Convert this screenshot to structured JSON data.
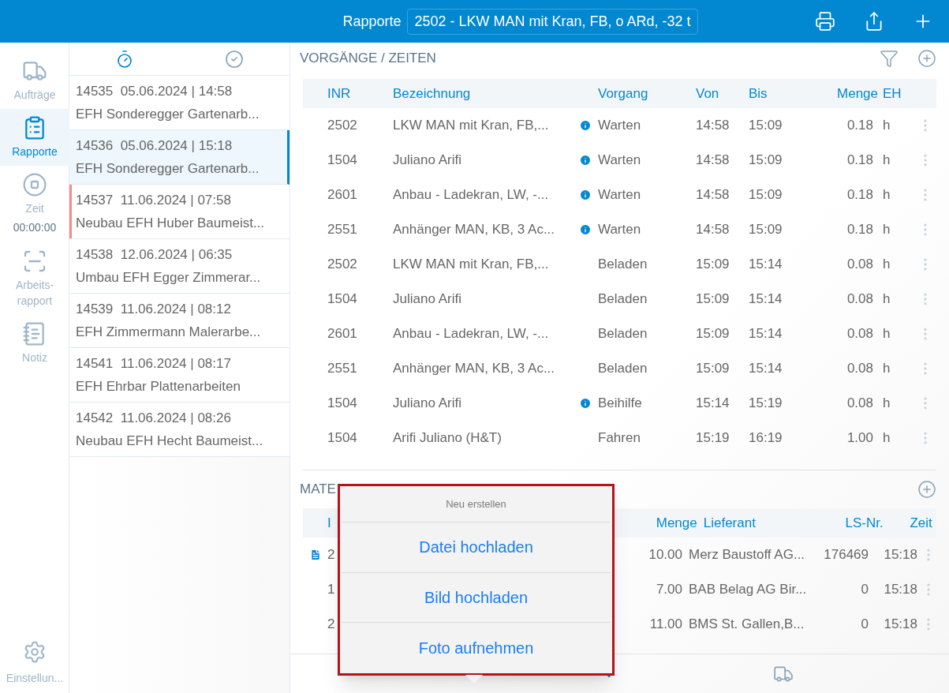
{
  "header": {
    "title": "Rapporte",
    "selector_value": "2502 - LKW MAN mit Kran, FB, o ARd, -32 t"
  },
  "sidebar": {
    "items": [
      {
        "kind": "truck",
        "label": "Aufträge",
        "selected": false
      },
      {
        "kind": "report",
        "label": "Rapporte",
        "selected": true
      },
      {
        "kind": "stop",
        "label": "Zeit",
        "selected": false,
        "timer": "00:00:00"
      },
      {
        "kind": "scan",
        "label": "Arbeits-rapport",
        "selected": false
      },
      {
        "kind": "note",
        "label": "Notiz",
        "selected": false
      }
    ],
    "footer_item": {
      "kind": "gear",
      "label": "Einstellun..."
    }
  },
  "report_list": {
    "tabs": [
      {
        "kind": "timer",
        "selected": true
      },
      {
        "kind": "check",
        "selected": false
      }
    ],
    "items": [
      {
        "number": "14535",
        "datetime": "05.06.2024 | 14:58",
        "title": "EFH Sonderegger Gartenarb...",
        "selected": false
      },
      {
        "number": "14536",
        "datetime": "05.06.2024 | 15:18",
        "title": "EFH Sonderegger Gartenarb...",
        "selected": true
      },
      {
        "number": "14537",
        "datetime": "11.06.2024 | 07:58",
        "title": "Neubau EFH Huber Baumeist...",
        "selected": false,
        "color": "#f28b8b"
      },
      {
        "number": "14538",
        "datetime": "12.06.2024 | 06:35",
        "title": "Umbau EFH Egger Zimmerar...",
        "selected": false
      },
      {
        "number": "14539",
        "datetime": "11.06.2024 | 08:12",
        "title": "EFH Zimmermann Malerarbe...",
        "selected": false
      },
      {
        "number": "14541",
        "datetime": "11.06.2024 | 08:17",
        "title": "EFH Ehrbar Plattenarbeiten",
        "selected": false
      },
      {
        "number": "14542",
        "datetime": "11.06.2024 | 08:26",
        "title": "Neubau EFH Hecht Baumeist...",
        "selected": false
      }
    ]
  },
  "times": {
    "title": "VORGÄNGE / ZEITEN",
    "columns": [
      "INR",
      "Bezeichnung",
      "Vorgang",
      "Von",
      "Bis",
      "Menge",
      "EH"
    ],
    "rows": [
      {
        "inr": "2502",
        "bezeichnung": "LKW MAN mit Kran, FB,...",
        "info": true,
        "vorgang": "Warten",
        "von": "14:58",
        "bis": "15:09",
        "menge": "0.18",
        "eh": "h"
      },
      {
        "inr": "1504",
        "bezeichnung": "Juliano Arifi",
        "info": true,
        "vorgang": "Warten",
        "von": "14:58",
        "bis": "15:09",
        "menge": "0.18",
        "eh": "h"
      },
      {
        "inr": "2601",
        "bezeichnung": "Anbau - Ladekran, LW, -...",
        "info": true,
        "vorgang": "Warten",
        "von": "14:58",
        "bis": "15:09",
        "menge": "0.18",
        "eh": "h"
      },
      {
        "inr": "2551",
        "bezeichnung": "Anhänger MAN, KB, 3 Ac...",
        "info": true,
        "vorgang": "Warten",
        "von": "14:58",
        "bis": "15:09",
        "menge": "0.18",
        "eh": "h"
      },
      {
        "inr": "2502",
        "bezeichnung": "LKW MAN mit Kran, FB,...",
        "info": false,
        "vorgang": "Beladen",
        "von": "15:09",
        "bis": "15:14",
        "menge": "0.08",
        "eh": "h"
      },
      {
        "inr": "1504",
        "bezeichnung": "Juliano Arifi",
        "info": false,
        "vorgang": "Beladen",
        "von": "15:09",
        "bis": "15:14",
        "menge": "0.08",
        "eh": "h"
      },
      {
        "inr": "2601",
        "bezeichnung": "Anbau - Ladekran, LW, -...",
        "info": false,
        "vorgang": "Beladen",
        "von": "15:09",
        "bis": "15:14",
        "menge": "0.08",
        "eh": "h"
      },
      {
        "inr": "2551",
        "bezeichnung": "Anhänger MAN, KB, 3 Ac...",
        "info": false,
        "vorgang": "Beladen",
        "von": "15:09",
        "bis": "15:14",
        "menge": "0.08",
        "eh": "h"
      },
      {
        "inr": "1504",
        "bezeichnung": "Juliano Arifi",
        "info": true,
        "vorgang": "Beihilfe",
        "von": "15:14",
        "bis": "15:19",
        "menge": "0.08",
        "eh": "h"
      },
      {
        "inr": "1504",
        "bezeichnung": "Arifi Juliano (H&T)",
        "info": false,
        "vorgang": "Fahren",
        "von": "15:19",
        "bis": "16:19",
        "menge": "1.00",
        "eh": "h"
      }
    ]
  },
  "material": {
    "title": "MATE",
    "columns": [
      "I",
      "Menge",
      "Lieferant",
      "LS-Nr.",
      "Zeit"
    ],
    "rows": [
      {
        "file": true,
        "inr": "2",
        "menge": "10.00",
        "lieferant": "Merz Baustoff AG...",
        "ls_nr": "176469",
        "zeit": "15:18"
      },
      {
        "file": false,
        "inr": "1",
        "menge": "7.00",
        "lieferant": "BAB Belag AG Bir...",
        "ls_nr": "0",
        "zeit": "15:18"
      },
      {
        "file": false,
        "inr": "2",
        "menge": "11.00",
        "lieferant": "BMS St. Gallen,B...",
        "ls_nr": "0",
        "zeit": "15:18"
      }
    ]
  },
  "popover": {
    "title": "Neu erstellen",
    "actions": [
      "Datei hochladen",
      "Bild hochladen",
      "Foto aufnehmen"
    ]
  }
}
